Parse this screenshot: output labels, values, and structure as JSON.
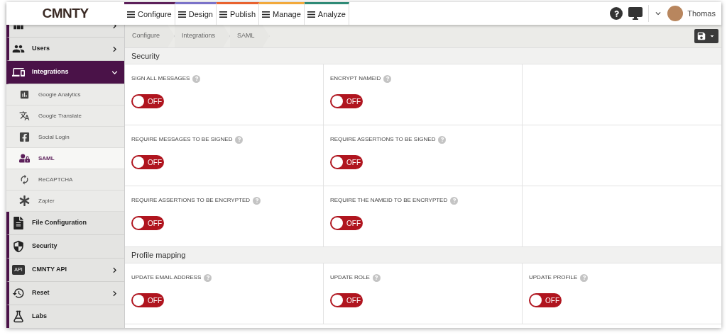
{
  "logo": "CMNTY",
  "nav_tabs": [
    {
      "label": "Configure",
      "color": "#5c1f5a"
    },
    {
      "label": "Design",
      "color": "#7b72c8"
    },
    {
      "label": "Publish",
      "color": "#e8622e"
    },
    {
      "label": "Manage",
      "color": "#f2a93b"
    },
    {
      "label": "Analyze",
      "color": "#2e8a76"
    }
  ],
  "user": {
    "name": "Thomas"
  },
  "sidebar": {
    "items": [
      {
        "selected": false,
        "expanded": false,
        "has_chevron": true
      },
      {
        "label": "Users",
        "selected": false,
        "expanded": false,
        "has_chevron": true
      },
      {
        "label": "Integrations",
        "selected": true,
        "expanded": true,
        "has_chevron": true,
        "children": [
          {
            "label": "Google Analytics",
            "selected": false
          },
          {
            "label": "Google Translate",
            "selected": false
          },
          {
            "label": "Social Login",
            "selected": false
          },
          {
            "label": "SAML",
            "selected": true
          },
          {
            "label": "ReCAPTCHA",
            "selected": false
          },
          {
            "label": "Zapier",
            "selected": false
          }
        ]
      },
      {
        "label": "File Configuration",
        "selected": false,
        "has_chevron": false
      },
      {
        "label": "Security",
        "selected": false,
        "has_chevron": false
      },
      {
        "label": "CMNTY API",
        "badge": "API",
        "selected": false,
        "expanded": false,
        "has_chevron": true
      },
      {
        "label": "Reset",
        "selected": false,
        "expanded": false,
        "has_chevron": true
      },
      {
        "label": "Labs",
        "selected": false,
        "has_chevron": false
      }
    ]
  },
  "breadcrumb": [
    "Configure",
    "Integrations",
    "SAML"
  ],
  "sections": [
    {
      "title": "Security",
      "rows": [
        [
          {
            "label": "SIGN ALL MESSAGES",
            "on": false,
            "state_text": "OFF"
          },
          {
            "label": "ENCRYPT NAMEID",
            "on": false,
            "state_text": "OFF"
          }
        ],
        [
          {
            "label": "REQUIRE MESSAGES TO BE SIGNED",
            "on": false,
            "state_text": "OFF"
          },
          {
            "label": "REQUIRE ASSERTIONS TO BE SIGNED",
            "on": false,
            "state_text": "OFF"
          }
        ],
        [
          {
            "label": "REQUIRE ASSERTIONS TO BE ENCRYPTED",
            "on": false,
            "state_text": "OFF"
          },
          {
            "label": "REQUIRE THE NAMEID TO BE ENCRYPTED",
            "on": false,
            "state_text": "OFF"
          }
        ]
      ]
    },
    {
      "title": "Profile mapping",
      "rows": [
        [
          {
            "label": "UPDATE EMAIL ADDRESS",
            "on": false,
            "state_text": "OFF"
          },
          {
            "label": "UPDATE ROLE",
            "on": false,
            "state_text": "OFF"
          },
          {
            "label": "UPDATE PROFILE",
            "on": false,
            "state_text": "OFF"
          }
        ]
      ]
    }
  ]
}
